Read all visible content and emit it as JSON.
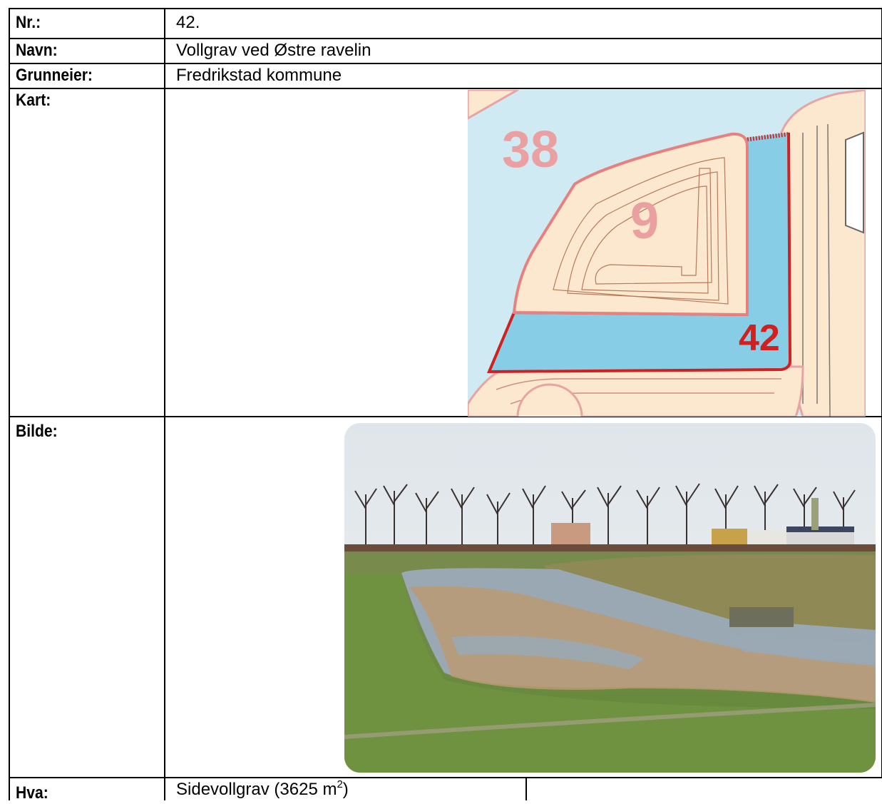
{
  "rows": {
    "nr": {
      "label": "Nr.:",
      "value": "42."
    },
    "navn": {
      "label": "Navn:",
      "value": "Vollgrav ved Østre ravelin"
    },
    "grunneier": {
      "label": "Grunneier:",
      "value": "Fredrikstad kommune"
    },
    "kart": {
      "label": "Kart:"
    },
    "bilde": {
      "label": "Bilde:"
    },
    "hva": {
      "label": "Hva:",
      "value_prefix": "Sidevollgrav (3625 m",
      "value_sup": "2",
      "value_suffix": ")"
    }
  },
  "map": {
    "area_labels": [
      "38",
      "9",
      "42"
    ],
    "colors": {
      "water": "#87cde6",
      "sea": "#cfeaf3",
      "land": "#fbe8cf",
      "outline": "#e06a6a",
      "highlight": "#d02020"
    }
  },
  "photo": {
    "colors": {
      "sky": "#e6ebee",
      "grass": "#6a8a3a",
      "reeds": "#b89a72",
      "water": "#9aa8b4"
    }
  }
}
